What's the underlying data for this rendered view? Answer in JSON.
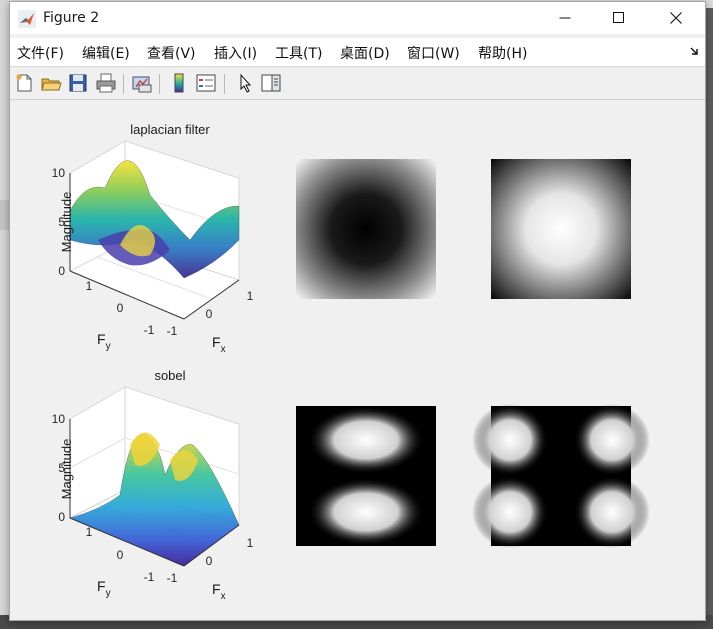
{
  "window": {
    "title": "Figure 2"
  },
  "menu": [
    "文件(F)",
    "编辑(E)",
    "查看(V)",
    "插入(I)",
    "工具(T)",
    "桌面(D)",
    "窗口(W)",
    "帮助(H)"
  ],
  "toolbar": [
    "new-figure",
    "open-file",
    "save",
    "print",
    "link-plot",
    "insert-colorbar",
    "insert-legend",
    "edit-plot-arrow",
    "property-inspector"
  ],
  "plots": {
    "laplacian": {
      "title": "laplacian filter",
      "zlabel": "Magnitude",
      "ylabel_main": "F",
      "ylabel_sub": "y",
      "xlabel_main": "F",
      "xlabel_sub": "x",
      "zticks": [
        "10",
        "5",
        "0"
      ],
      "yticks": [
        "1",
        "0",
        "-1"
      ],
      "xticks": [
        "-1",
        "0",
        "1"
      ]
    },
    "sobel": {
      "title": "sobel",
      "zlabel": "Magnitude",
      "ylabel_main": "F",
      "ylabel_sub": "y",
      "xlabel_main": "F",
      "xlabel_sub": "x",
      "zticks": [
        "10",
        "5",
        "0"
      ],
      "yticks": [
        "1",
        "0",
        "-1"
      ],
      "xticks": [
        "-1",
        "0",
        "1"
      ]
    }
  },
  "images": [
    "laplacian-magnitude-dark-center",
    "laplacian-magnitude-bright-center",
    "sobel-magnitude-horizontal",
    "sobel-magnitude-vertical"
  ]
}
